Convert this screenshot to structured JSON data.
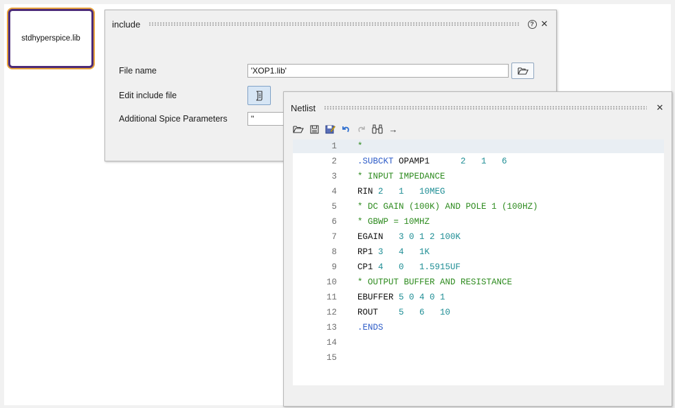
{
  "block": {
    "label": "stdhyperspice.lib"
  },
  "include_dialog": {
    "title": "include",
    "help_glyph": "?",
    "close_glyph": "✕",
    "fields": {
      "file_name_label": "File name",
      "file_name_value": "'XOP1.lib'",
      "edit_include_label": "Edit include file",
      "additional_label": "Additional Spice Parameters",
      "additional_value": "''"
    }
  },
  "netlist_dialog": {
    "title": "Netlist",
    "close_glyph": "✕",
    "toolbar": [
      "open-icon",
      "save-icon",
      "save-as-icon",
      "undo-icon",
      "redo-icon",
      "find-icon",
      "goto-arrow-icon"
    ],
    "arrow_glyph": "→",
    "lines": [
      {
        "n": "1",
        "segs": [
          [
            "cmt",
            "*"
          ]
        ]
      },
      {
        "n": "2",
        "segs": [
          [
            "kw",
            ".SUBCKT"
          ],
          [
            "tx",
            " OPAMP1      "
          ],
          [
            "num",
            "2   1   6"
          ]
        ]
      },
      {
        "n": "3",
        "segs": [
          [
            "cmt",
            "* INPUT IMPEDANCE"
          ]
        ]
      },
      {
        "n": "4",
        "segs": [
          [
            "tx",
            "RIN "
          ],
          [
            "num",
            "2   1   10MEG"
          ]
        ]
      },
      {
        "n": "5",
        "segs": [
          [
            "cmt",
            "* DC GAIN (100K) AND POLE 1 (100HZ)"
          ]
        ]
      },
      {
        "n": "6",
        "segs": [
          [
            "cmt",
            "* GBWP = 10MHZ"
          ]
        ]
      },
      {
        "n": "7",
        "segs": [
          [
            "tx",
            "EGAIN   "
          ],
          [
            "num",
            "3 0 1 2 100K"
          ]
        ]
      },
      {
        "n": "8",
        "segs": [
          [
            "tx",
            "RP1 "
          ],
          [
            "num",
            "3   4   1K"
          ]
        ]
      },
      {
        "n": "9",
        "segs": [
          [
            "tx",
            "CP1 "
          ],
          [
            "num",
            "4   0   1.5915UF"
          ]
        ]
      },
      {
        "n": "10",
        "segs": [
          [
            "cmt",
            "* OUTPUT BUFFER AND RESISTANCE"
          ]
        ]
      },
      {
        "n": "11",
        "segs": [
          [
            "tx",
            "EBUFFER "
          ],
          [
            "num",
            "5 0 4 0 1"
          ]
        ]
      },
      {
        "n": "12",
        "segs": [
          [
            "tx",
            "ROUT    "
          ],
          [
            "num",
            "5   6   10"
          ]
        ]
      },
      {
        "n": "13",
        "segs": [
          [
            "kw",
            ".ENDS"
          ]
        ]
      },
      {
        "n": "14",
        "segs": []
      },
      {
        "n": "15",
        "segs": []
      }
    ]
  }
}
